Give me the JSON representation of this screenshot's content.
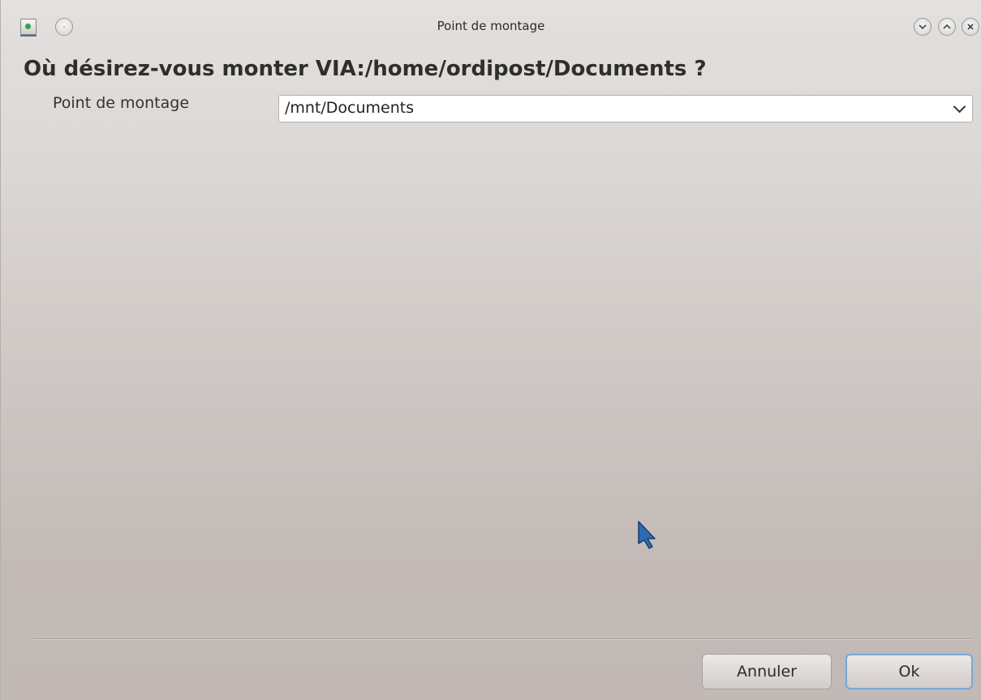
{
  "window": {
    "title": "Point de montage"
  },
  "dialog": {
    "question": "Où désirez-vous monter VIA:/home/ordipost/Documents ?",
    "mount_point_label": "Point de montage",
    "mount_point_value": "/mnt/Documents"
  },
  "buttons": {
    "cancel_label": "Annuler",
    "ok_label": "Ok"
  },
  "icons": {
    "app": "app-icon",
    "menu": "window-menu-icon",
    "minimize": "minimize-icon",
    "maximize": "maximize-icon",
    "close": "close-icon",
    "dropdown": "chevron-down-icon",
    "pointer": "mouse-pointer-icon"
  },
  "colors": {
    "focus_accent": "#7aa6d6",
    "cursor_blue": "#2c6bb3"
  }
}
